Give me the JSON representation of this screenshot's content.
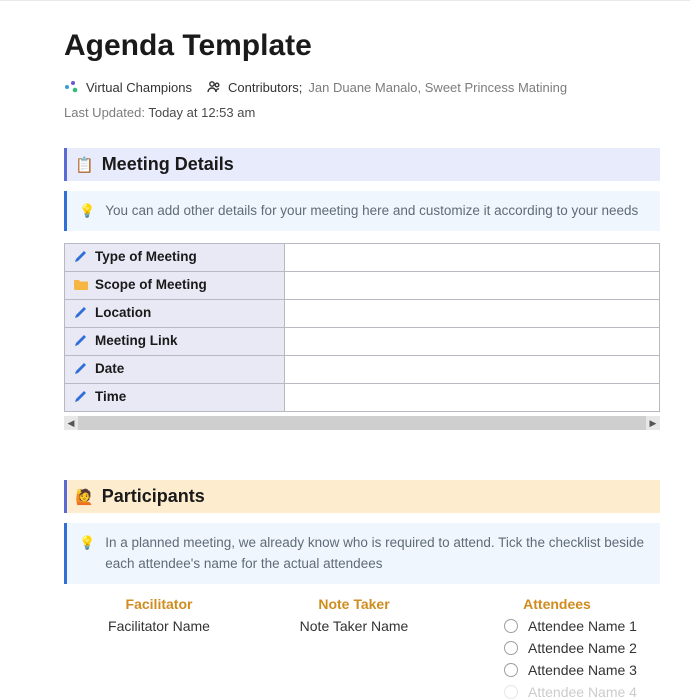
{
  "title": "Agenda Template",
  "workspace": {
    "icon": "sparkle-icon",
    "name": "Virtual Champions"
  },
  "contributors": {
    "icon": "people-icon",
    "label": "Contributors;",
    "names": "Jan Duane Manalo, Sweet Princess Matining"
  },
  "last_updated": {
    "label": "Last Updated:",
    "value": "Today at 12:53 am"
  },
  "sections": {
    "meeting_details": {
      "icon": "📋",
      "title": "Meeting Details",
      "callout_icon": "💡",
      "callout": "You can add other details for your meeting here and customize it according to your needs",
      "rows": [
        {
          "icon": "pencil",
          "label": "Type of Meeting",
          "value": ""
        },
        {
          "icon": "folder",
          "label": "Scope of Meeting",
          "value": ""
        },
        {
          "icon": "pencil",
          "label": "Location",
          "value": ""
        },
        {
          "icon": "pencil",
          "label": "Meeting Link",
          "value": ""
        },
        {
          "icon": "pencil",
          "label": "Date",
          "value": ""
        },
        {
          "icon": "pencil",
          "label": "Time",
          "value": ""
        }
      ]
    },
    "participants": {
      "icon": "🙋",
      "title": "Participants",
      "callout_icon": "💡",
      "callout": "In a planned meeting, we already know who is required to attend. Tick the checklist beside each attendee's name for the actual attendees",
      "roles": {
        "facilitator": {
          "header": "Facilitator",
          "value": "Facilitator Name"
        },
        "note_taker": {
          "header": "Note Taker",
          "value": "Note Taker Name"
        },
        "attendees": {
          "header": "Attendees",
          "items": [
            {
              "label": "Attendee Name 1",
              "checked": false
            },
            {
              "label": "Attendee Name 2",
              "checked": false
            },
            {
              "label": "Attendee Name 3",
              "checked": false
            },
            {
              "label": "Attendee Name 4",
              "checked": false
            }
          ]
        }
      }
    }
  }
}
